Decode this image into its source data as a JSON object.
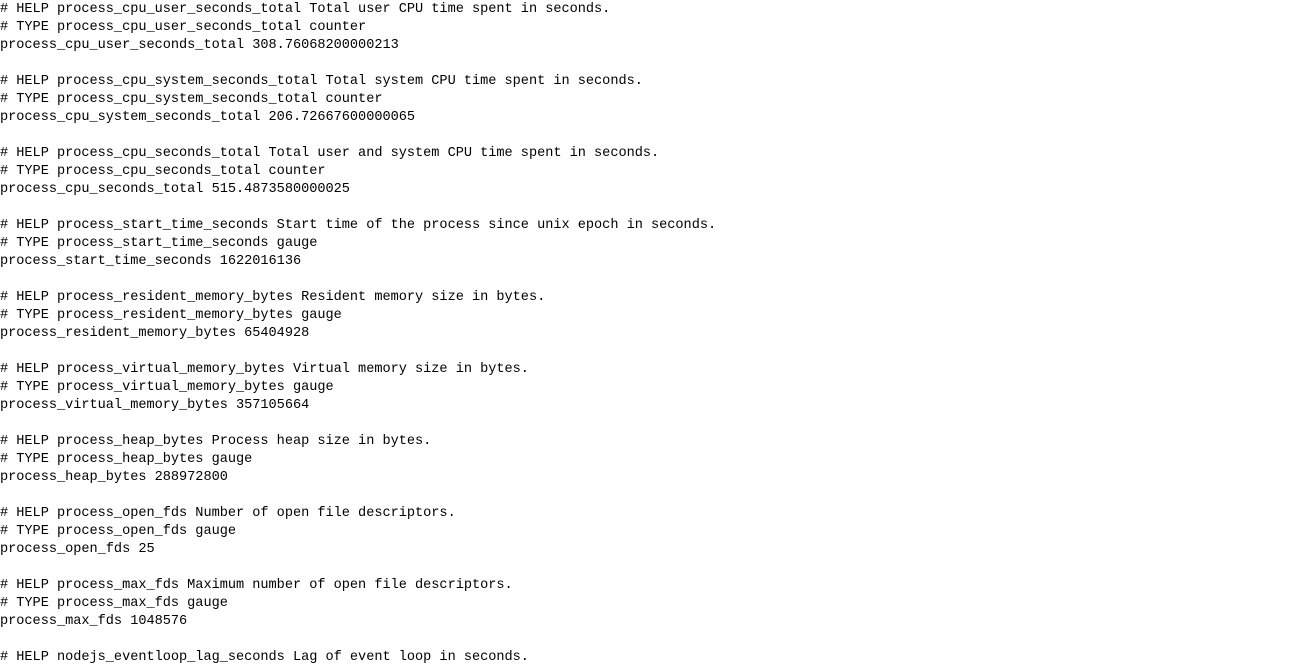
{
  "page": {
    "type": "prometheus-metrics-plaintext",
    "background_color": "#ffffff",
    "text_color": "#000000",
    "content_lines": [
      "# HELP process_cpu_user_seconds_total Total user CPU time spent in seconds.",
      "# TYPE process_cpu_user_seconds_total counter",
      "process_cpu_user_seconds_total 308.76068200000213",
      "",
      "# HELP process_cpu_system_seconds_total Total system CPU time spent in seconds.",
      "# TYPE process_cpu_system_seconds_total counter",
      "process_cpu_system_seconds_total 206.72667600000065",
      "",
      "# HELP process_cpu_seconds_total Total user and system CPU time spent in seconds.",
      "# TYPE process_cpu_seconds_total counter",
      "process_cpu_seconds_total 515.4873580000025",
      "",
      "# HELP process_start_time_seconds Start time of the process since unix epoch in seconds.",
      "# TYPE process_start_time_seconds gauge",
      "process_start_time_seconds 1622016136",
      "",
      "# HELP process_resident_memory_bytes Resident memory size in bytes.",
      "# TYPE process_resident_memory_bytes gauge",
      "process_resident_memory_bytes 65404928",
      "",
      "# HELP process_virtual_memory_bytes Virtual memory size in bytes.",
      "# TYPE process_virtual_memory_bytes gauge",
      "process_virtual_memory_bytes 357105664",
      "",
      "# HELP process_heap_bytes Process heap size in bytes.",
      "# TYPE process_heap_bytes gauge",
      "process_heap_bytes 288972800",
      "",
      "# HELP process_open_fds Number of open file descriptors.",
      "# TYPE process_open_fds gauge",
      "process_open_fds 25",
      "",
      "# HELP process_max_fds Maximum number of open file descriptors.",
      "# TYPE process_max_fds gauge",
      "process_max_fds 1048576",
      "",
      "# HELP nodejs_eventloop_lag_seconds Lag of event loop in seconds."
    ],
    "metrics": [
      {
        "name": "process_cpu_user_seconds_total",
        "help": "Total user CPU time spent in seconds.",
        "type": "counter",
        "value": "308.76068200000213"
      },
      {
        "name": "process_cpu_system_seconds_total",
        "help": "Total system CPU time spent in seconds.",
        "type": "counter",
        "value": "206.72667600000065"
      },
      {
        "name": "process_cpu_seconds_total",
        "help": "Total user and system CPU time spent in seconds.",
        "type": "counter",
        "value": "515.4873580000025"
      },
      {
        "name": "process_start_time_seconds",
        "help": "Start time of the process since unix epoch in seconds.",
        "type": "gauge",
        "value": "1622016136"
      },
      {
        "name": "process_resident_memory_bytes",
        "help": "Resident memory size in bytes.",
        "type": "gauge",
        "value": "65404928"
      },
      {
        "name": "process_virtual_memory_bytes",
        "help": "Virtual memory size in bytes.",
        "type": "gauge",
        "value": "357105664"
      },
      {
        "name": "process_heap_bytes",
        "help": "Process heap size in bytes.",
        "type": "gauge",
        "value": "288972800"
      },
      {
        "name": "process_open_fds",
        "help": "Number of open file descriptors.",
        "type": "gauge",
        "value": "25"
      },
      {
        "name": "process_max_fds",
        "help": "Maximum number of open file descriptors.",
        "type": "gauge",
        "value": "1048576"
      },
      {
        "name": "nodejs_eventloop_lag_seconds",
        "help": "Lag of event loop in seconds.",
        "type": "",
        "value": ""
      }
    ]
  }
}
